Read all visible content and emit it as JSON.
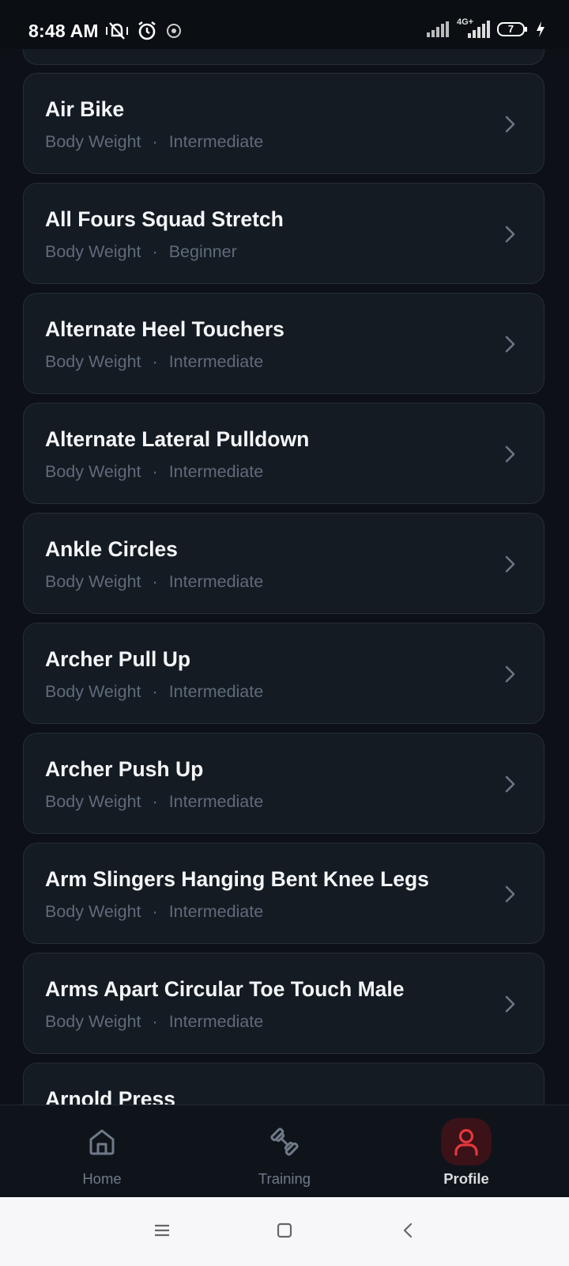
{
  "status_bar": {
    "time": "8:48 AM",
    "left_icons": [
      "mute-vibrate-icon",
      "alarm-icon",
      "app-notification-icon"
    ],
    "right_icons": [
      "signal-icon",
      "signal-4g-icon",
      "battery-icon",
      "charging-icon"
    ],
    "network_label": "4G+",
    "battery_level": "7"
  },
  "exercises": [
    {
      "title": "",
      "equipment": "",
      "level": "",
      "partial": true
    },
    {
      "title": "Air Bike",
      "equipment": "Body Weight",
      "level": "Intermediate"
    },
    {
      "title": "All Fours Squad Stretch",
      "equipment": "Body Weight",
      "level": "Beginner"
    },
    {
      "title": "Alternate Heel Touchers",
      "equipment": "Body Weight",
      "level": "Intermediate"
    },
    {
      "title": "Alternate Lateral Pulldown",
      "equipment": "Body Weight",
      "level": "Intermediate"
    },
    {
      "title": "Ankle Circles",
      "equipment": "Body Weight",
      "level": "Intermediate"
    },
    {
      "title": "Archer Pull Up",
      "equipment": "Body Weight",
      "level": "Intermediate"
    },
    {
      "title": "Archer Push Up",
      "equipment": "Body Weight",
      "level": "Intermediate"
    },
    {
      "title": "Arm Slingers Hanging Bent Knee Legs",
      "equipment": "Body Weight",
      "level": "Intermediate"
    },
    {
      "title": "Arms Apart Circular Toe Touch Male",
      "equipment": "Body Weight",
      "level": "Intermediate"
    },
    {
      "title": "Arnold Press",
      "equipment": "",
      "level": "",
      "partial": true
    }
  ],
  "separator": "·",
  "bottom_nav": [
    {
      "label": "Home",
      "icon": "home-icon",
      "active": false
    },
    {
      "label": "Training",
      "icon": "dumbbell-icon",
      "active": false
    },
    {
      "label": "Profile",
      "icon": "user-icon",
      "active": true
    }
  ],
  "colors": {
    "background": "#0d1117",
    "card": "#151b23",
    "card_border": "#262d36",
    "subtitle": "#5f6b7a",
    "accent": "#e5383b"
  },
  "system_nav": [
    "menu-icon",
    "home-square-icon",
    "back-icon"
  ]
}
